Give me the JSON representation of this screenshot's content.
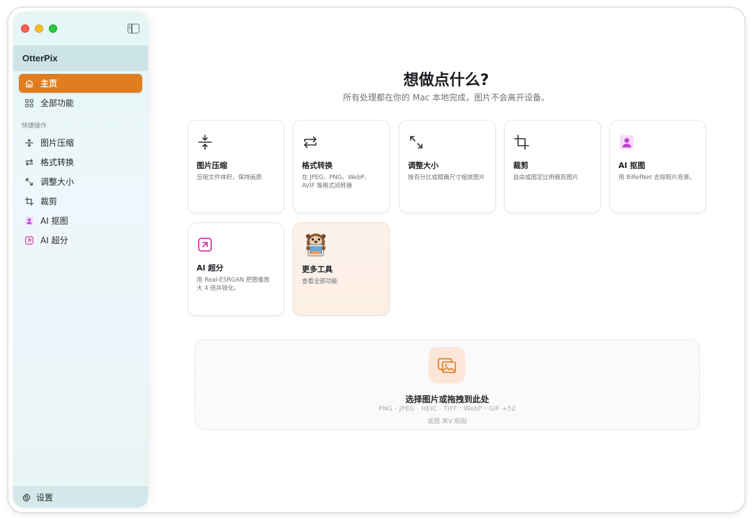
{
  "app": {
    "name": "OtterPix"
  },
  "sidebar": {
    "nav": [
      {
        "label": "主页",
        "icon": "home-icon",
        "active": true
      },
      {
        "label": "全部功能",
        "icon": "grid-icon",
        "active": false
      }
    ],
    "section_label": "快捷操作",
    "quick": [
      {
        "label": "图片压缩",
        "icon": "compress-icon"
      },
      {
        "label": "格式转换",
        "icon": "convert-icon"
      },
      {
        "label": "调整大小",
        "icon": "resize-icon"
      },
      {
        "label": "裁剪",
        "icon": "crop-icon"
      },
      {
        "label": "AI 抠图",
        "icon": "person-cutout-icon"
      },
      {
        "label": "AI 超分",
        "icon": "upscale-icon"
      }
    ],
    "footer": {
      "label": "设置",
      "icon": "gear-icon"
    }
  },
  "main": {
    "title": "想做点什么?",
    "subtitle": "所有处理都在你的 Mac 本地完成，图片不会离开设备。",
    "cards": [
      {
        "title": "图片压缩",
        "desc": "压缩文件体积，保持画质",
        "icon": "compress-icon"
      },
      {
        "title": "格式转换",
        "desc": "在 JPEG、PNG、WebP、AVIF 等格式间转换",
        "icon": "convert-icon"
      },
      {
        "title": "调整大小",
        "desc": "按百分比或精确尺寸缩放图片",
        "icon": "resize-icon"
      },
      {
        "title": "裁剪",
        "desc": "自由或固定比例裁剪图片",
        "icon": "crop-icon"
      },
      {
        "title": "AI 抠图",
        "desc": "用 BiRefNet 去除照片背景。",
        "icon": "person-cutout-icon"
      },
      {
        "title": "AI 超分",
        "desc": "用 Real-ESRGAN 把图像放大 4 倍并锐化。",
        "icon": "upscale-icon"
      },
      {
        "title": "更多工具",
        "desc": "查看全部功能",
        "icon": "otter-mascot-icon"
      }
    ],
    "dropzone": {
      "title": "选择图片或拖拽到此处",
      "formats": "PNG · JPEG · HEIC · TIFF · WebP · GIF +52",
      "hint": "或按 ⌘V 粘贴",
      "icon": "photos-icon"
    }
  },
  "colors": {
    "accent": "#e07d1f",
    "ai_purple": "#c23fd6",
    "upscale_pink": "#d6379f"
  }
}
